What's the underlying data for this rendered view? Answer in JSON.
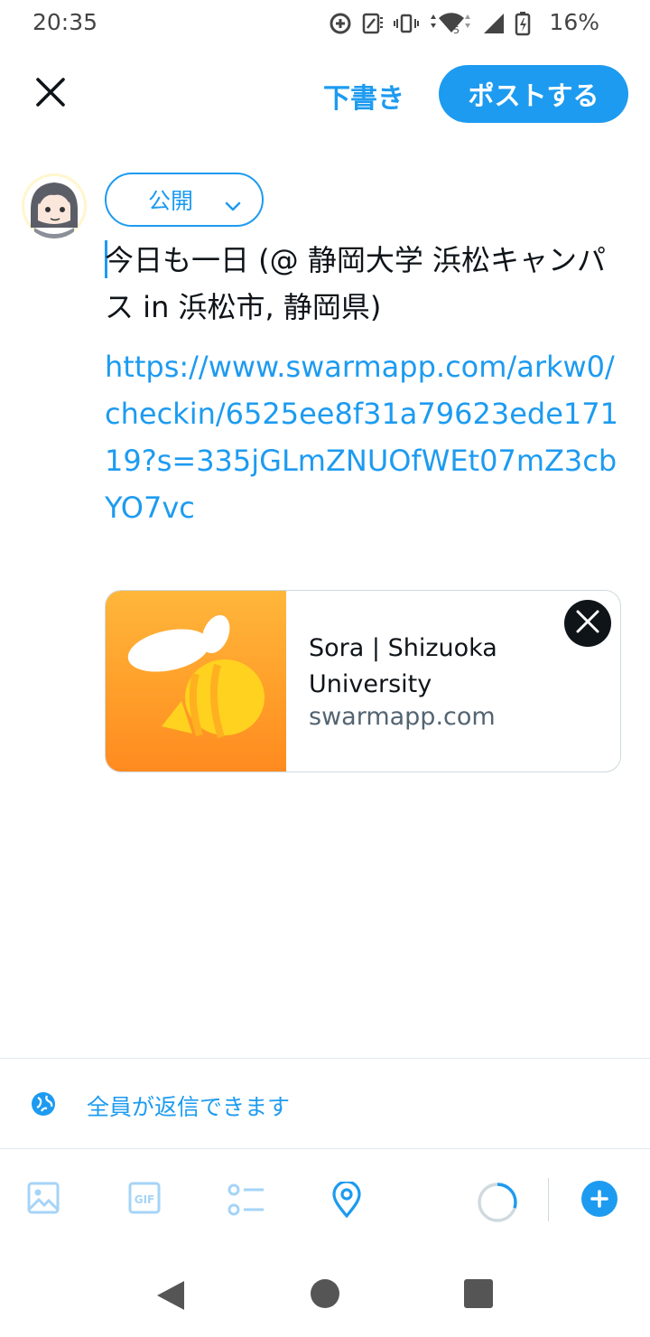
{
  "status_bar": {
    "time": "20:35",
    "battery_percent": "16%",
    "network_badge": "5"
  },
  "header": {
    "close_icon": "close-icon",
    "draft_label": "下書き",
    "post_label": "ポストする"
  },
  "composer": {
    "audience_label": "公開",
    "text": "今日も一日 (@ 静岡大学 浜松キャンパス in 浜松市, 静岡県)",
    "url": "https://www.swarmapp.com/arkw0/checkin/6525ee8f31a79623ede17119?s=335jGLmZNUOfWEt07mZ3cbYO7vc"
  },
  "link_card": {
    "title": "Sora | Shizuoka University",
    "domain": "swarmapp.com"
  },
  "reply_setting": {
    "label": "全員が返信できます"
  },
  "toolbar": {
    "items": [
      "image-icon",
      "gif-icon",
      "poll-icon",
      "location-icon",
      "character-count-ring",
      "add-post-icon"
    ],
    "gif_text": "GIF",
    "char_ring_progress": 0.3
  },
  "colors": {
    "accent": "#1d9bf0",
    "text": "#0f1419",
    "muted": "#536471",
    "swarm_orange": "#ff9f2a",
    "swarm_bee": "#ffd21f"
  }
}
